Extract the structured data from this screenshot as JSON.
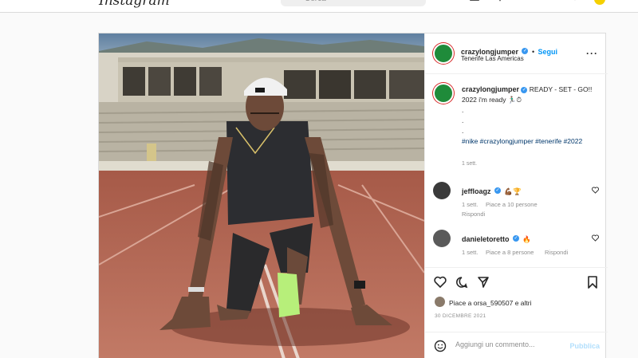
{
  "nav": {
    "logo": "Instagram",
    "search_placeholder": "Cerca",
    "icons": [
      "home-icon",
      "messenger-icon",
      "new-post-icon",
      "explore-icon",
      "activity-icon",
      "profile-avatar"
    ]
  },
  "post": {
    "author": "crazylongjumper",
    "follow_label": "Segui",
    "location": "Tenerife Las Americas",
    "caption_lines": [
      "READY - SET - GO!!",
      "2022 i'm ready 🏃🏽‍♂️⏱",
      ".",
      ".",
      "."
    ],
    "hashtags": "#nike #crazylongjumper #tenerife #2022",
    "caption_time": "1 sett.",
    "comments": [
      {
        "user": "jeffloagz",
        "text": "💪🏾🏆",
        "time": "1 sett.",
        "likes": "Piace a 10 persone",
        "reply": "Rispondi"
      },
      {
        "user": "danieletoretto",
        "text": "🔥",
        "time": "1 sett.",
        "likes": "Piace a 8 persone",
        "reply": "Rispondi"
      }
    ],
    "liked_by": "Piace a orsa_590507 e altri",
    "date": "30 DICEMBRE 2021",
    "comment_placeholder": "Aggiungi un commento...",
    "publish_label": "Pubblica"
  },
  "colors": {
    "link_blue": "#0095f6",
    "hashtag_blue": "#00376b",
    "track_red": "#b46e5c"
  }
}
